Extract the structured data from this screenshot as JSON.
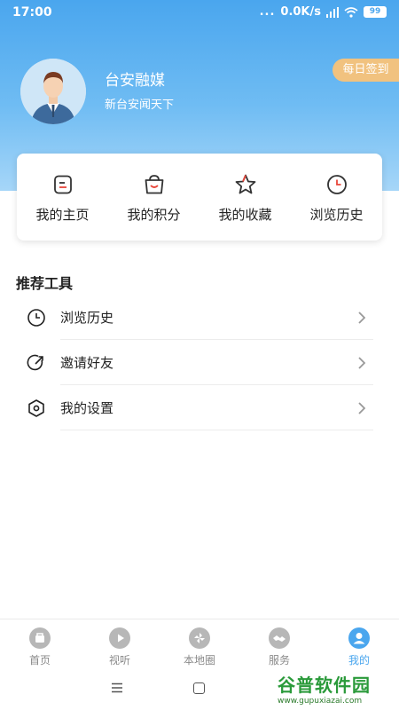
{
  "status_bar": {
    "time": "17:00",
    "dots": "...",
    "network_speed": "0.0K/s",
    "battery": "99"
  },
  "profile": {
    "username": "台安融媒",
    "subtitle": "新台安闻天下",
    "checkin_label": "每日签到"
  },
  "quick_actions": [
    {
      "label": "我的主页",
      "icon": "homepage-icon"
    },
    {
      "label": "我的积分",
      "icon": "points-bag-icon"
    },
    {
      "label": "我的收藏",
      "icon": "star-icon"
    },
    {
      "label": "浏览历史",
      "icon": "clock-icon"
    }
  ],
  "tools": {
    "title": "推荐工具",
    "items": [
      {
        "label": "浏览历史",
        "icon": "clock-icon"
      },
      {
        "label": "邀请好友",
        "icon": "share-arrow-icon"
      },
      {
        "label": "我的设置",
        "icon": "settings-hexagon-icon"
      }
    ]
  },
  "tab_bar": {
    "items": [
      {
        "label": "首页",
        "icon": "home-icon",
        "active": false
      },
      {
        "label": "视听",
        "icon": "play-icon",
        "active": false
      },
      {
        "label": "本地圈",
        "icon": "pinwheel-icon",
        "active": false
      },
      {
        "label": "服务",
        "icon": "handshake-icon",
        "active": false
      },
      {
        "label": "我的",
        "icon": "user-icon",
        "active": true
      }
    ]
  },
  "watermark": {
    "name": "谷普软件园",
    "url": "www.gupuxiazai.com"
  },
  "colors": {
    "accent": "#4aa6ee",
    "checkin": "#f1c27f",
    "header_gradient_top": "#4aa6ee",
    "header_gradient_bottom": "#a6d6f8"
  }
}
